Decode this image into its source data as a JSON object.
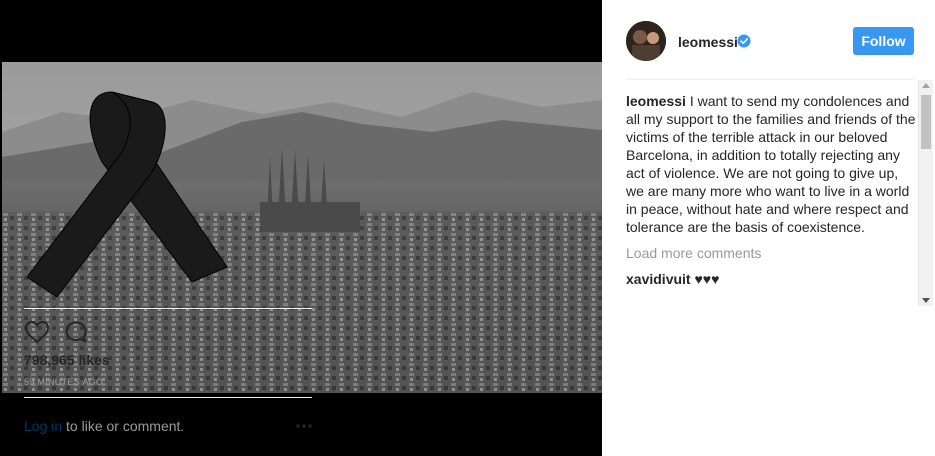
{
  "post": {
    "username": "leomessi",
    "follow_label": "Follow",
    "caption_username": "leomessi",
    "caption_text": " I want to send my condolences and all my support to the families and friends of the victims of the terrible attack in our beloved Barcelona, in addition to totally rejecting any act of violence. We are not going to give up, we are many more who want to live in a world in peace, without hate and where respect and tolerance are the basis of coexistence.",
    "load_more_label": "Load more comments",
    "comments": [
      {
        "username": "xavidivuit",
        "text": " ♥♥♥"
      }
    ],
    "likes": "798,965 likes",
    "time": "59 MINUTES AGO"
  },
  "footer": {
    "login_link": "Log in",
    "login_suffix": " to like or comment."
  },
  "icons": {
    "verified": "verified-badge-icon",
    "like": "heart-icon",
    "comment": "speech-bubble-icon",
    "more": "more-options-icon"
  },
  "colors": {
    "follow_button": "#3897f0",
    "verified": "#3897f0",
    "link": "#003569",
    "muted": "#999999",
    "text": "#262626"
  }
}
